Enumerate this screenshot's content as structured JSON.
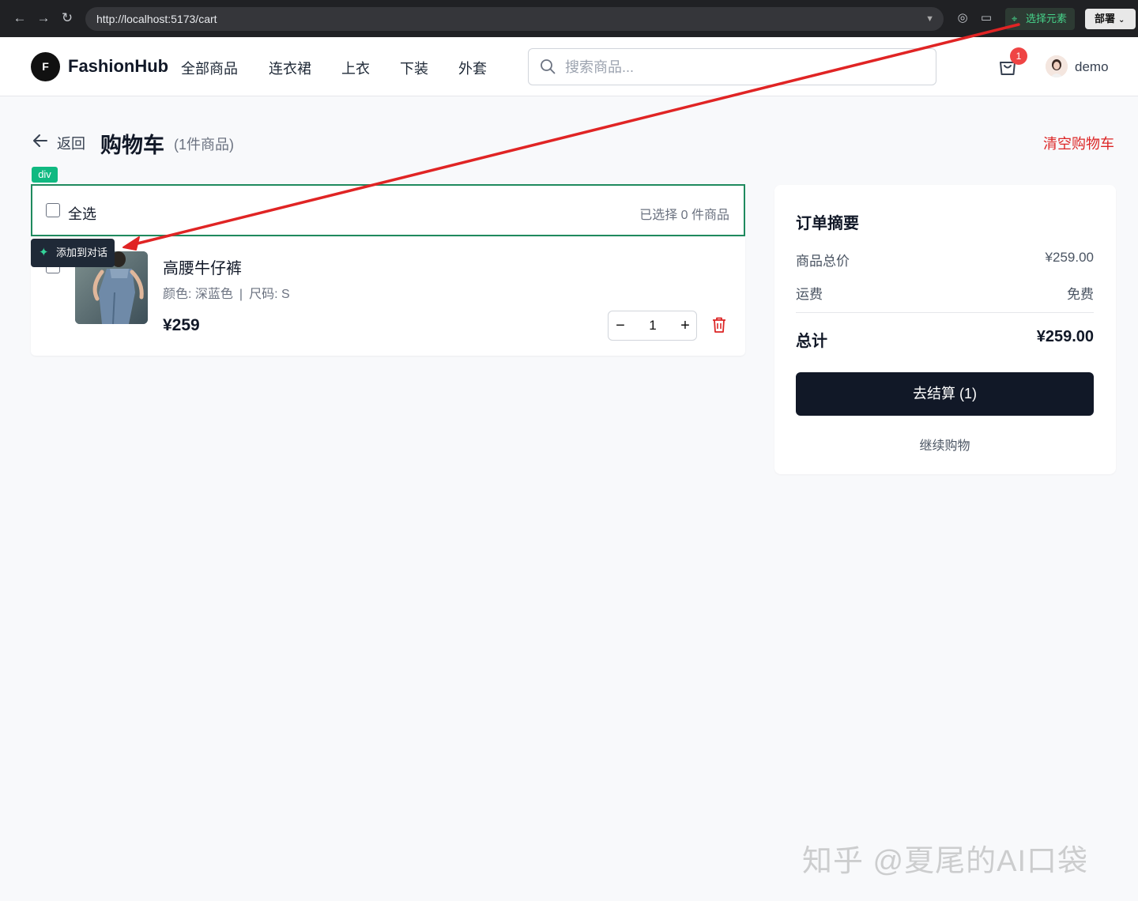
{
  "browser": {
    "url": "http://localhost:5173/cart",
    "pick_element_label": "选择元素",
    "deploy_label": "部署"
  },
  "header": {
    "logo_letter": "F",
    "brand": "FashionHub",
    "nav": [
      "全部商品",
      "连衣裙",
      "上衣",
      "下装",
      "外套"
    ],
    "search_placeholder": "搜索商品...",
    "cart_badge": "1",
    "username": "demo"
  },
  "page": {
    "back_label": "返回",
    "title": "购物车",
    "item_count": "(1件商品)",
    "clear_label": "清空购物车"
  },
  "inspector": {
    "tag": "div",
    "add_to_chat": "添加到对话"
  },
  "cart": {
    "select_all_label": "全选",
    "selected_count": "已选择 0 件商品",
    "items": [
      {
        "name": "高腰牛仔裤",
        "color": "颜色: 深蓝色",
        "size": "尺码: S",
        "price": "¥259",
        "quantity": "1"
      }
    ]
  },
  "summary": {
    "title": "订单摘要",
    "subtotal_label": "商品总价",
    "subtotal_value": "¥259.00",
    "shipping_label": "运费",
    "shipping_value": "免费",
    "total_label": "总计",
    "total_value": "¥259.00",
    "checkout_label": "去结算 (1)",
    "continue_label": "继续购物"
  },
  "watermark": "知乎 @夏尾的AI口袋",
  "colors": {
    "accent_dark": "#111827",
    "danger": "#dc2626",
    "inspector_green": "#10b981",
    "annotation_red": "#e02424"
  }
}
